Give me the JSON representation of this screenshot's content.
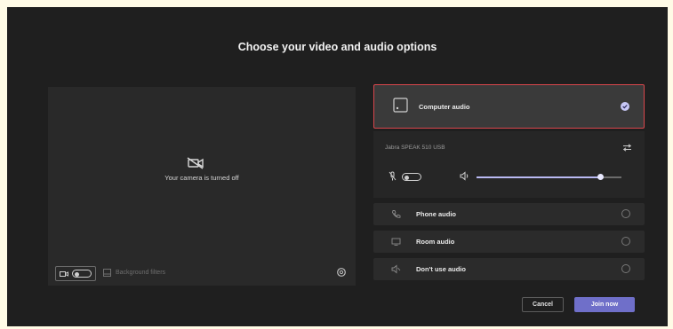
{
  "dialog": {
    "title": "Choose your video and audio options"
  },
  "video": {
    "camera_off_text": "Your camera is turned off",
    "background_filters_label": "Background filters",
    "camera_on": false
  },
  "audio": {
    "computer_audio": {
      "label": "Computer audio",
      "selected": true
    },
    "device_name": "Jabra SPEAK 510 USB",
    "mic_on": false,
    "speaker_volume": 0.85,
    "options": [
      {
        "label": "Phone audio",
        "selected": false,
        "icon": "phone-icon"
      },
      {
        "label": "Room audio",
        "selected": false,
        "icon": "room-icon"
      },
      {
        "label": "Don't use audio",
        "selected": false,
        "icon": "no-audio-icon"
      }
    ]
  },
  "actions": {
    "cancel_label": "Cancel",
    "join_label": "Join now"
  },
  "colors": {
    "accent": "#6f6fc9",
    "selection_border": "#d9464c",
    "background": "#1f1f1f"
  }
}
